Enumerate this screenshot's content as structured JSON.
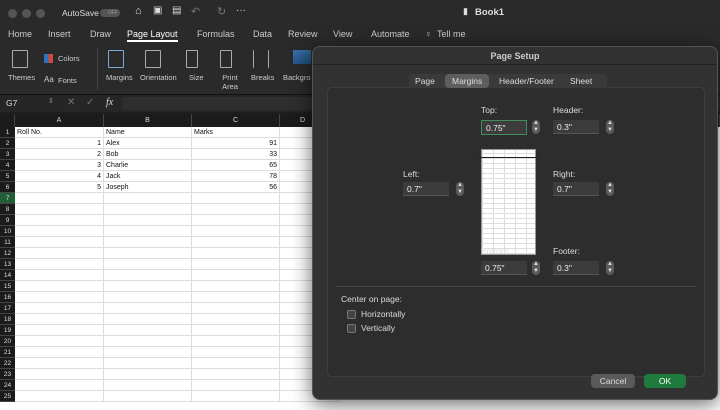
{
  "titlebar": {
    "autosave": "AutoSave",
    "autosave_state": "OFF",
    "doc_title": "Book1"
  },
  "tabs": [
    "Home",
    "Insert",
    "Draw",
    "Page Layout",
    "Formulas",
    "Data",
    "Review",
    "View",
    "Automate",
    "Tell me"
  ],
  "ribbon": {
    "themes": "Themes",
    "colors": "Colors",
    "fonts": "Fonts",
    "margins": "Margins",
    "orientation": "Orientation",
    "size": "Size",
    "print_area": "Print Area",
    "breaks": "Breaks",
    "background": "Backgro"
  },
  "formula_bar": {
    "name_box": "G7",
    "fx": "fx",
    "value": ""
  },
  "columns": [
    "A",
    "B",
    "C",
    "D"
  ],
  "rows": [
    {
      "a": "Roll No.",
      "b": "Name",
      "c": "Marks"
    },
    {
      "a": "1",
      "b": "Alex",
      "c": "91"
    },
    {
      "a": "2",
      "b": "Bob",
      "c": "33"
    },
    {
      "a": "3",
      "b": "Charlie",
      "c": "65"
    },
    {
      "a": "4",
      "b": "Jack",
      "c": "78"
    },
    {
      "a": "5",
      "b": "Joseph",
      "c": "56"
    }
  ],
  "row_count": 25,
  "dialog": {
    "title": "Page Setup",
    "tabs": [
      "Page",
      "Margins",
      "Header/Footer",
      "Sheet"
    ],
    "active_tab": "Margins",
    "top_label": "Top:",
    "top": "0.75\"",
    "header_label": "Header:",
    "header": "0.3\"",
    "left_label": "Left:",
    "left": "0.7\"",
    "right_label": "Right:",
    "right": "0.7\"",
    "bottom_label": "Bottom:",
    "bottom": "0.75\"",
    "footer_label": "Footer:",
    "footer": "0.3\"",
    "center_label": "Center on page:",
    "horizontally": "Horizontally",
    "vertically": "Vertically",
    "cancel": "Cancel",
    "ok": "OK"
  },
  "colors": {
    "accent": "#1f7a3d",
    "focus": "#3f8f5a"
  }
}
